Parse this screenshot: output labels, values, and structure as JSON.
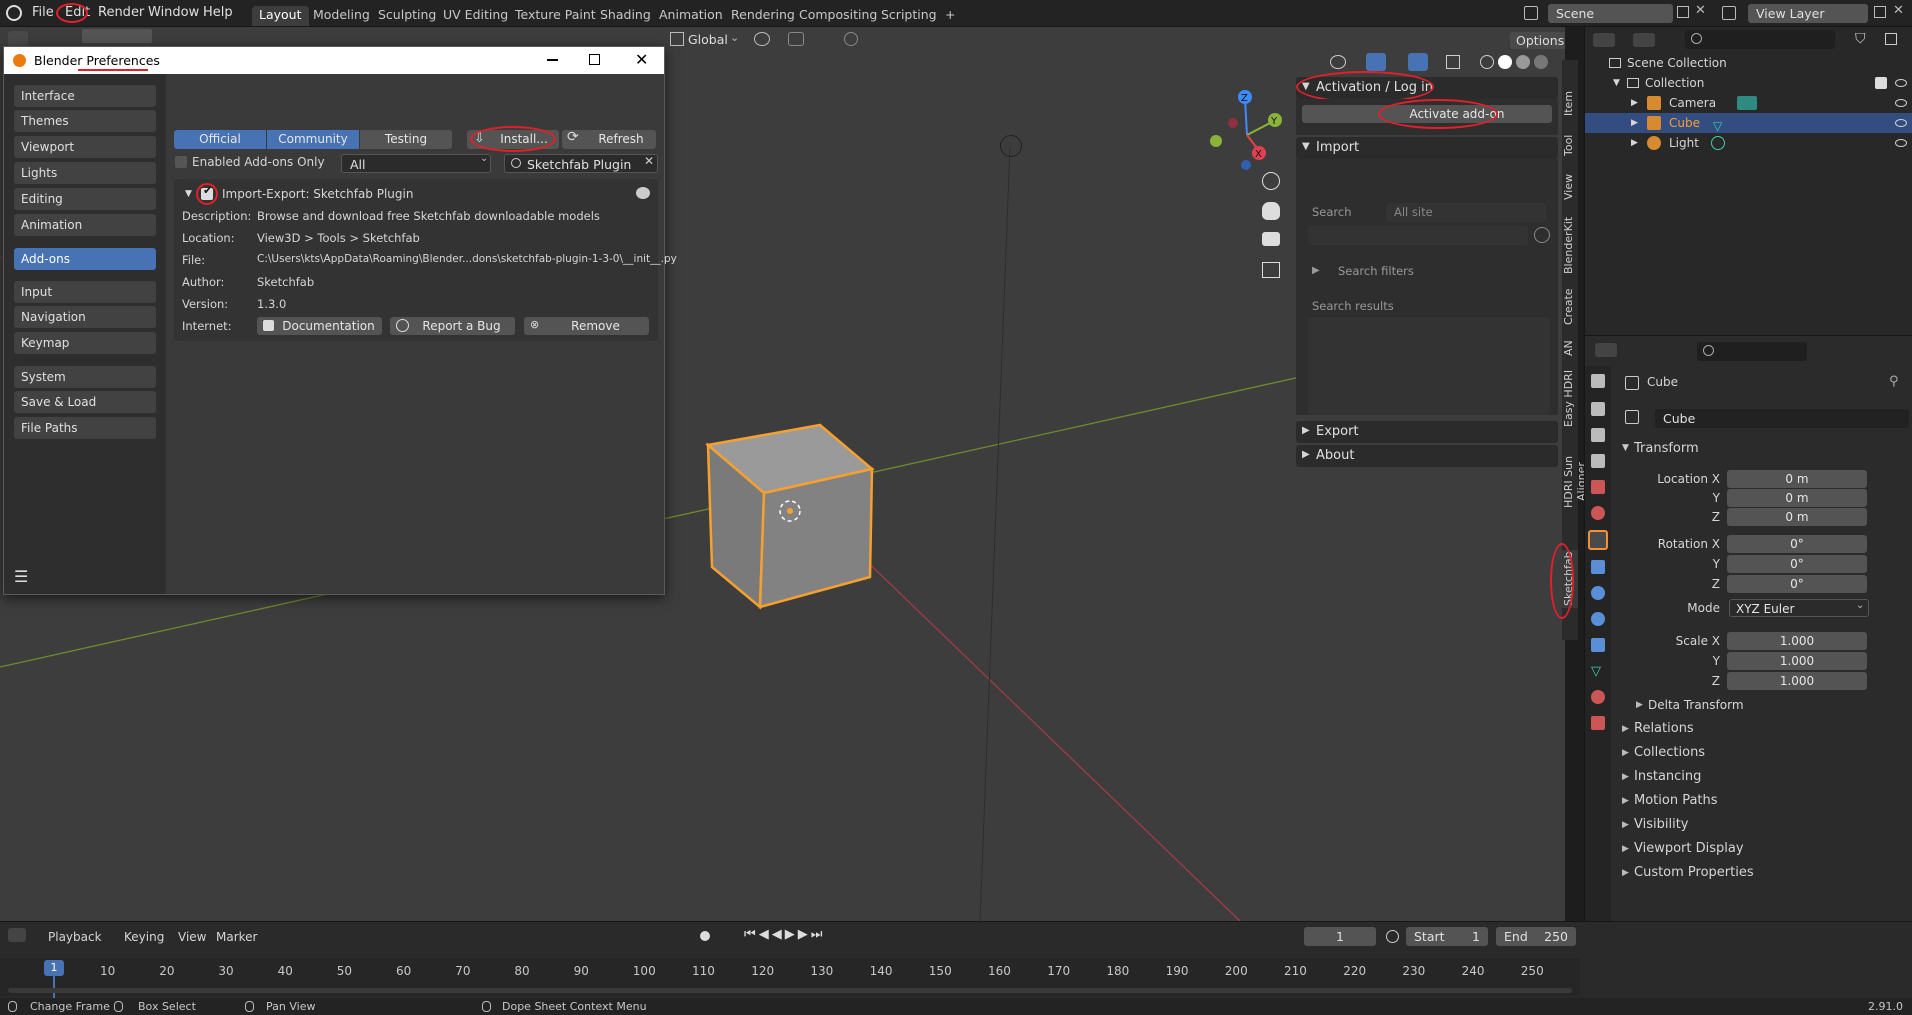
{
  "topbar": {
    "menus": [
      "File",
      "Edit",
      "Render",
      "Window",
      "Help"
    ],
    "workspaces": [
      "Layout",
      "Modeling",
      "Sculpting",
      "UV Editing",
      "Texture Paint",
      "Shading",
      "Animation",
      "Rendering",
      "Compositing",
      "Scripting"
    ],
    "add_tab": "+",
    "scene": "Scene",
    "view_layer": "View Layer"
  },
  "viewport": {
    "orientation": "Global",
    "options": "Options"
  },
  "npanel": {
    "activation": "Activation / Log in",
    "activate_btn": "Activate add-on",
    "import": "Import",
    "search_label": "Search",
    "search_scope": "All site",
    "search_filters": "Search filters",
    "search_results": "Search results",
    "export": "Export",
    "about": "About",
    "tabs": [
      "Item",
      "Tool",
      "View",
      "BlenderKit",
      "Create",
      "AN",
      "Easy HDRI",
      "HDRI Sun Aligner",
      "Sketchfab"
    ]
  },
  "outliner": {
    "scene_collection": "Scene Collection",
    "collection": "Collection",
    "items": [
      "Camera",
      "Cube",
      "Light"
    ]
  },
  "properties": {
    "object_name": "Cube",
    "data_name": "Cube",
    "transform": "Transform",
    "location_label": "Location X",
    "y": "Y",
    "z": "Z",
    "loc": [
      "0 m",
      "0 m",
      "0 m"
    ],
    "rotation_label": "Rotation X",
    "rot": [
      "0°",
      "0°",
      "0°"
    ],
    "mode_label": "Mode",
    "mode": "XYZ Euler",
    "scale_label": "Scale X",
    "scale": [
      "1.000",
      "1.000",
      "1.000"
    ],
    "delta": "Delta Transform",
    "sections": [
      "Relations",
      "Collections",
      "Instancing",
      "Motion Paths",
      "Visibility",
      "Viewport Display",
      "Custom Properties"
    ]
  },
  "prefs": {
    "title_a": "Blender ",
    "title_b": "Preferences",
    "nav": [
      "Interface",
      "Themes",
      "Viewport",
      "Lights",
      "Editing",
      "Animation",
      "Add-ons",
      "Input",
      "Navigation",
      "Keymap",
      "System",
      "Save & Load",
      "File Paths"
    ],
    "tabs": [
      "Official",
      "Community",
      "Testing"
    ],
    "install": "Install...",
    "refresh": "Refresh",
    "enabled_only": "Enabled Add-ons Only",
    "category": "All",
    "search": "Sketchfab Plugin",
    "addon_name": "Import-Export: Sketchfab Plugin",
    "description_lbl": "Description:",
    "description": "Browse and download free Sketchfab downloadable models",
    "location_lbl": "Location:",
    "location": "View3D > Tools > Sketchfab",
    "file_lbl": "File:",
    "file": "C:\\Users\\kts\\AppData\\Roaming\\Blender...dons\\sketchfab-plugin-1-3-0\\__init__.py",
    "author_lbl": "Author:",
    "author": "Sketchfab",
    "version_lbl": "Version:",
    "version": "1.3.0",
    "internet_lbl": "Internet:",
    "documentation": "Documentation",
    "report_bug": "Report a Bug",
    "remove": "Remove"
  },
  "timeline": {
    "playback": "Playback",
    "keying": "Keying",
    "view": "View",
    "marker": "Marker",
    "current_frame": "1",
    "start_lbl": "Start",
    "start": "1",
    "end_lbl": "End",
    "end": "250",
    "ticks": [
      "10",
      "20",
      "30",
      "40",
      "50",
      "60",
      "70",
      "80",
      "90",
      "100",
      "110",
      "120",
      "130",
      "140",
      "150",
      "160",
      "170",
      "180",
      "190",
      "200",
      "210",
      "220",
      "230",
      "240",
      "250"
    ],
    "cursor": "1"
  },
  "statusbar": {
    "change_frame": "Change Frame",
    "box_select": "Box Select",
    "pan_view": "Pan View",
    "context_menu": "Dope Sheet Context Menu",
    "version": "2.91.0"
  },
  "colors": {
    "accent": "#4772b3",
    "selection": "#f5a030",
    "annotation": "#e0202a"
  }
}
